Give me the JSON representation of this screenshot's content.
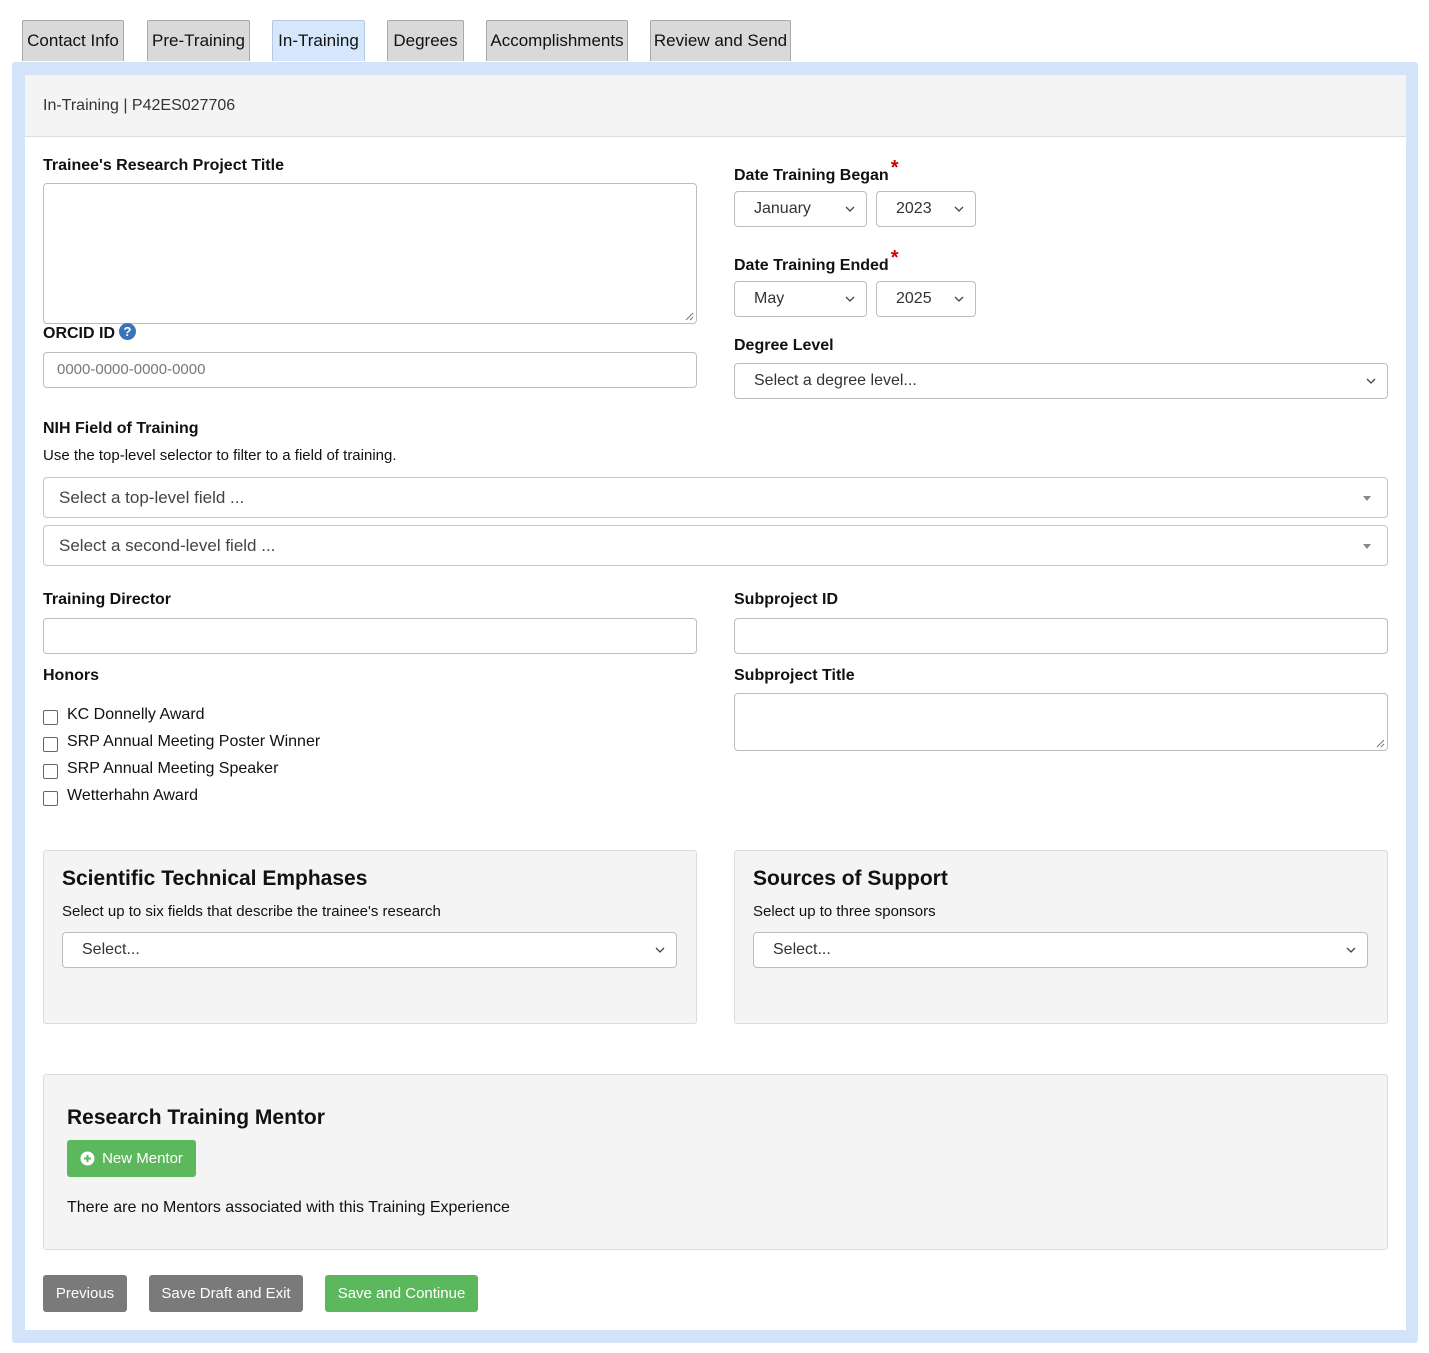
{
  "tabs": [
    {
      "label": "Contact Info",
      "active": false
    },
    {
      "label": "Pre-Training",
      "active": false
    },
    {
      "label": "In-Training",
      "active": true
    },
    {
      "label": "Degrees",
      "active": false
    },
    {
      "label": "Accomplishments",
      "active": false
    },
    {
      "label": "Review and Send",
      "active": false
    }
  ],
  "header": {
    "title": "In-Training | P42ES027706"
  },
  "form": {
    "project_title": {
      "label": "Trainee's Research Project Title",
      "value": ""
    },
    "orcid": {
      "label": "ORCID ID",
      "placeholder": "0000-0000-0000-0000",
      "help_icon": "question-circle-icon"
    },
    "date_began": {
      "label": "Date Training Began",
      "month": "January",
      "year": "2023"
    },
    "date_ended": {
      "label": "Date Training Ended",
      "month": "May",
      "year": "2025"
    },
    "degree_level": {
      "label": "Degree Level",
      "selected": "Select a degree level..."
    },
    "nih_field": {
      "label": "NIH Field of Training",
      "help": "Use the top-level selector to filter to a field of training.",
      "top_placeholder": "Select a top-level field ...",
      "second_placeholder": "Select a second-level field ..."
    },
    "training_director": {
      "label": "Training Director",
      "value": ""
    },
    "subproject_id": {
      "label": "Subproject ID",
      "value": ""
    },
    "subproject_title": {
      "label": "Subproject Title",
      "value": ""
    },
    "honors": {
      "label": "Honors",
      "items": [
        "KC Donnelly Award",
        "SRP Annual Meeting Poster Winner",
        "SRP Annual Meeting Speaker",
        "Wetterhahn Award"
      ]
    }
  },
  "emphases": {
    "title": "Scientific Technical Emphases",
    "help": "Select up to six fields that describe the trainee's research",
    "selected": "Select..."
  },
  "support": {
    "title": "Sources of Support",
    "help": "Select up to three sponsors",
    "selected": "Select..."
  },
  "mentor": {
    "title": "Research Training Mentor",
    "new_button": "New Mentor",
    "empty_text": "There are no Mentors associated with this Training Experience"
  },
  "footer": {
    "previous": "Previous",
    "save_draft": "Save Draft and Exit",
    "save_continue": "Save and Continue"
  },
  "colors": {
    "accent_blue": "#d3e4fa",
    "success_green": "#5cb85c",
    "required_red": "#d40000"
  }
}
